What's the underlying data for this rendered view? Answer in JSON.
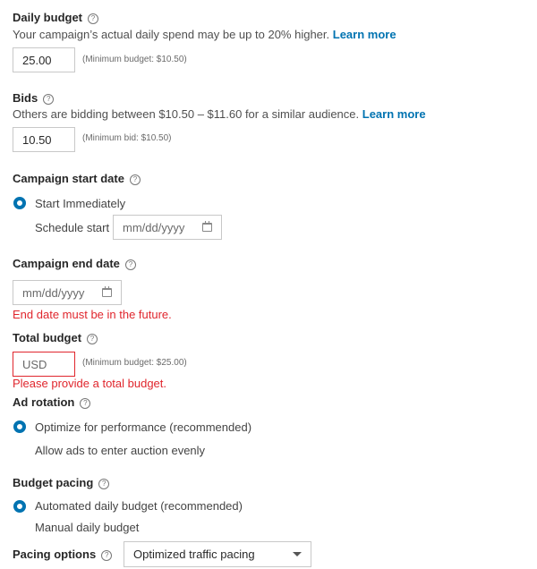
{
  "daily_budget": {
    "label": "Daily budget",
    "help_icon": "question-circle-icon",
    "description": "Your campaign’s actual daily spend may be up to 20% higher.",
    "learn_more": "Learn more",
    "value": "25.00",
    "hint": "(Minimum budget: $10.50)"
  },
  "bids": {
    "label": "Bids",
    "description": "Others are bidding between $10.50 – $11.60 for a similar audience.",
    "learn_more": "Learn more",
    "value": "10.50",
    "hint": "(Minimum bid: $10.50)"
  },
  "start_date": {
    "label": "Campaign start date",
    "option_immediately": "Start Immediately",
    "option_schedule": "Schedule start",
    "selected": "Start Immediately",
    "date_placeholder": "mm/dd/yyyy"
  },
  "end_date": {
    "label": "Campaign end date",
    "date_placeholder": "mm/dd/yyyy",
    "error": "End date must be in the future."
  },
  "total_budget": {
    "label": "Total budget",
    "placeholder": "USD",
    "hint": "(Minimum budget: $25.00)",
    "error": "Please provide a total budget."
  },
  "ad_rotation": {
    "label": "Ad rotation",
    "options": [
      "Optimize for performance (recommended)",
      "Allow ads to enter auction evenly"
    ],
    "selected": "Optimize for performance (recommended)"
  },
  "budget_pacing": {
    "label": "Budget pacing",
    "options": [
      "Automated daily budget (recommended)",
      "Manual daily budget"
    ],
    "selected": "Automated daily budget (recommended)"
  },
  "pacing_options": {
    "label": "Pacing options",
    "selected": "Optimized traffic pacing"
  },
  "colors": {
    "accent": "#0073b1",
    "error": "#e0262d"
  }
}
